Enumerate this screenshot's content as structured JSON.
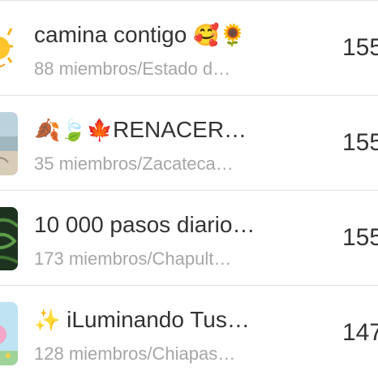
{
  "groups": [
    {
      "title": "camina contigo",
      "title_emoji": "🥰🌻",
      "subtitle": "88 miembros/Estado d…",
      "count": "155",
      "thumb_icon": "sun-icon"
    },
    {
      "title_emoji": "🍂🍃🍁",
      "title": "RENACER…",
      "subtitle": "35 miembros/Zacateca…",
      "count": "155",
      "thumb_icon": "beach-photo"
    },
    {
      "title": "10 000 pasos diario…",
      "subtitle": "173 miembros/Chapult…",
      "count": "155",
      "thumb_icon": "garden-maze-photo"
    },
    {
      "title_emoji": "✨",
      "title": "iLuminando Tus…",
      "subtitle": "128 miembros/Chiapas…",
      "count": "147",
      "thumb_icon": "cartoon-pink-photo"
    }
  ]
}
